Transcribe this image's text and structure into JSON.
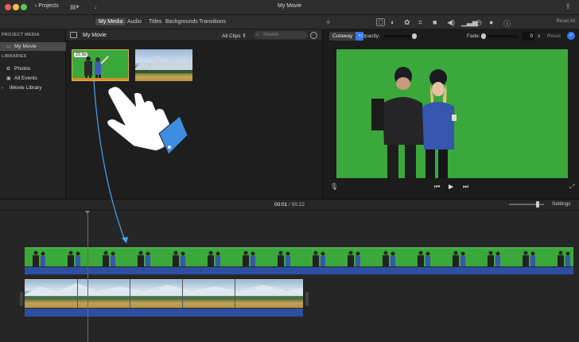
{
  "titlebar": {
    "projects": "Projects",
    "title": "My Movie"
  },
  "tabs": [
    {
      "label": "My Media",
      "active": true
    },
    {
      "label": "Audio"
    },
    {
      "label": "Titles"
    },
    {
      "label": "Backgrounds"
    },
    {
      "label": "Transitions"
    }
  ],
  "reset_all": "Reset All",
  "sidebar": {
    "project_media_heading": "PROJECT MEDIA",
    "project_item": "My Movie",
    "libraries_heading": "LIBRARIES",
    "library_items": [
      "Photos",
      "All Events",
      "iMovie Library"
    ]
  },
  "browser": {
    "title": "My Movie",
    "filter": "All Clips",
    "search_placeholder": "Search",
    "clip_duration": "22.9s"
  },
  "viewer": {
    "overlay_mode": "Cutaway",
    "opacity_label": "Opacity:",
    "fade_label": "Fade:",
    "fade_value": "0",
    "fade_unit": "s",
    "reset_label": "Reset"
  },
  "timeline": {
    "current_time": "00:01",
    "separator": "/",
    "total_time": "00:22",
    "settings_label": "Settings"
  },
  "colors": {
    "accent": "#3478f6",
    "greenscreen": "#3aa83a",
    "audio_track": "#2c4fa1",
    "selection": "#d8b24a"
  }
}
